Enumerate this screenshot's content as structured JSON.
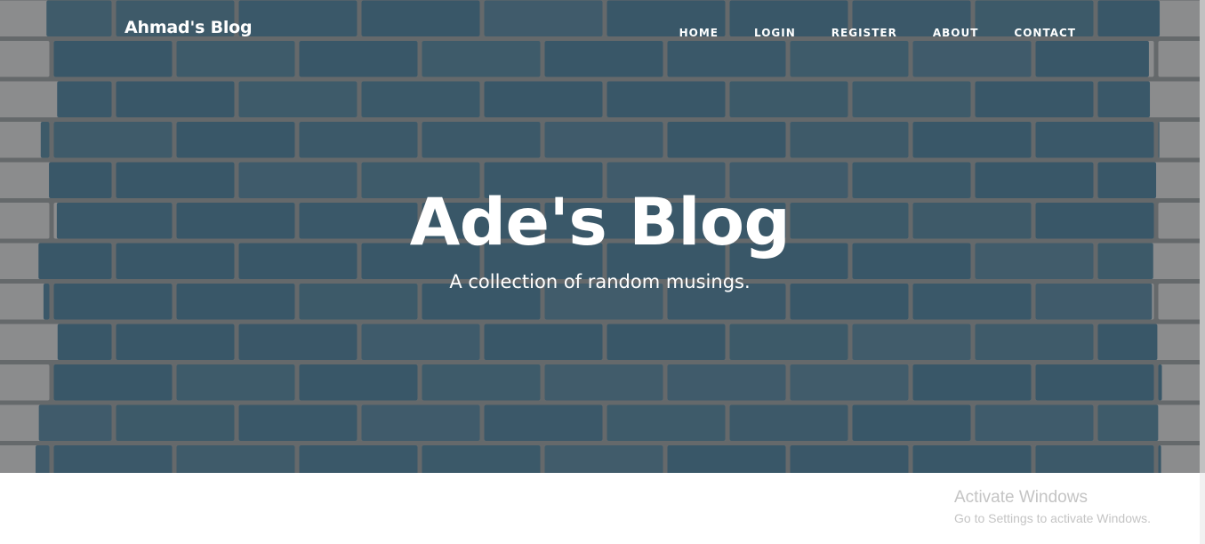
{
  "navbar": {
    "brand": "Ahmad's Blog",
    "links": [
      {
        "label": "HOME"
      },
      {
        "label": "LOGIN"
      },
      {
        "label": "REGISTER"
      },
      {
        "label": "ABOUT"
      },
      {
        "label": "CONTACT"
      }
    ]
  },
  "hero": {
    "title": "Ade's Blog",
    "subtitle": "A collection of random musings."
  },
  "watermark": {
    "title": "Activate Windows",
    "subtitle": "Go to Settings to activate Windows."
  },
  "colors": {
    "brick_blue": "#3d5f72",
    "brick_gray": "#9a9b9d",
    "mortar": "#6f7376",
    "text": "#ffffff"
  }
}
